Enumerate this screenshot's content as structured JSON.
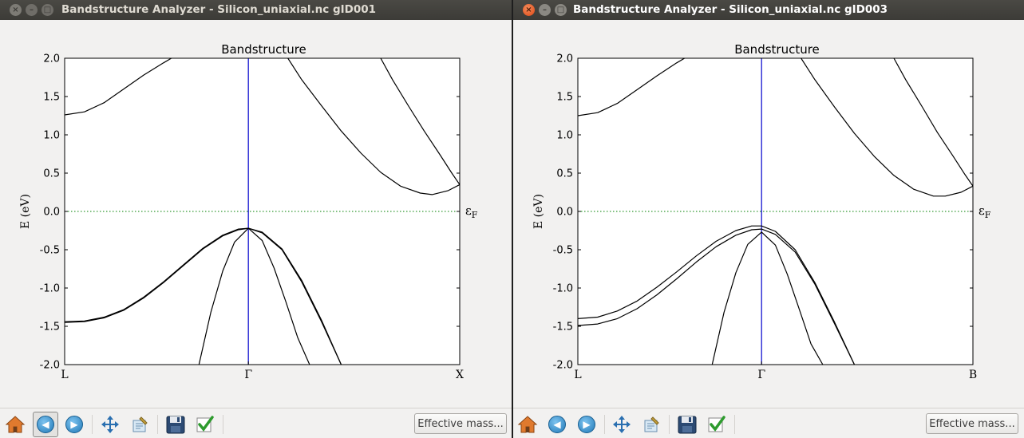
{
  "windows": [
    {
      "id": "win1",
      "title": "Bandstructure Analyzer - Silicon_uniaxial.nc gID001",
      "chart_data": {
        "type": "line",
        "title": "Bandstructure",
        "ylabel": "E (eV)",
        "ylim": [
          -2.0,
          2.0
        ],
        "xlim": [
          0,
          1
        ],
        "yticks": [
          "2.0",
          "1.5",
          "1.0",
          "0.5",
          "0.0",
          "-0.5",
          "-1.0",
          "-1.5",
          "-2.0"
        ],
        "xtick_labels": [
          "L",
          "Γ",
          "X"
        ],
        "xtick_positions": [
          0,
          0.465,
          1
        ],
        "fermi_label": "εF",
        "fermi_level": 0.0,
        "gamma_line_color": "#0000cc",
        "fermi_line_color": "#008000",
        "series": [
          {
            "x": [
              0.0,
              0.05,
              0.1,
              0.15,
              0.2,
              0.25,
              0.27
            ],
            "y": [
              1.26,
              1.3,
              1.42,
              1.6,
              1.78,
              1.94,
              2.0
            ]
          },
          {
            "x": [
              0.565,
              0.6,
              0.65,
              0.7,
              0.75,
              0.8,
              0.85,
              0.9,
              0.93,
              0.97,
              1.0
            ],
            "y": [
              2.0,
              1.72,
              1.38,
              1.05,
              0.76,
              0.51,
              0.33,
              0.24,
              0.22,
              0.27,
              0.35
            ]
          },
          {
            "x": [
              0.8,
              0.83,
              0.87,
              0.91,
              0.95,
              0.98,
              1.0
            ],
            "y": [
              2.0,
              1.72,
              1.38,
              1.05,
              0.74,
              0.5,
              0.35
            ]
          },
          {
            "x": [
              0.0,
              0.05,
              0.1,
              0.15,
              0.2,
              0.25,
              0.3,
              0.35,
              0.4,
              0.44,
              0.465,
              0.5,
              0.55,
              0.6,
              0.65,
              0.7
            ],
            "y": [
              -1.44,
              -1.43,
              -1.38,
              -1.28,
              -1.12,
              -0.92,
              -0.7,
              -0.48,
              -0.31,
              -0.23,
              -0.22,
              -0.27,
              -0.49,
              -0.9,
              -1.42,
              -2.0
            ]
          },
          {
            "x": [
              0.0,
              0.05,
              0.1,
              0.15,
              0.2,
              0.25,
              0.3,
              0.35,
              0.4,
              0.44,
              0.465,
              0.5,
              0.55,
              0.6,
              0.65,
              0.7
            ],
            "y": [
              -1.45,
              -1.44,
              -1.39,
              -1.29,
              -1.13,
              -0.93,
              -0.71,
              -0.49,
              -0.32,
              -0.24,
              -0.22,
              -0.28,
              -0.5,
              -0.92,
              -1.44,
              -2.0
            ]
          },
          {
            "x": [
              0.34,
              0.37,
              0.4,
              0.43,
              0.465,
              0.5,
              0.53,
              0.56,
              0.59,
              0.62
            ],
            "y": [
              -2.0,
              -1.32,
              -0.78,
              -0.4,
              -0.22,
              -0.38,
              -0.74,
              -1.18,
              -1.65,
              -2.0
            ]
          }
        ]
      },
      "toolbar": {
        "effective_mass_label": "Effective mass...",
        "active_button": "back"
      }
    },
    {
      "id": "win2",
      "title": "Bandstructure Analyzer - Silicon_uniaxial.nc gID003",
      "chart_data": {
        "type": "line",
        "title": "Bandstructure",
        "ylabel": "E (eV)",
        "ylim": [
          -2.0,
          2.0
        ],
        "xlim": [
          0,
          1
        ],
        "yticks": [
          "2.0",
          "1.5",
          "1.0",
          "0.5",
          "0.0",
          "-0.5",
          "-1.0",
          "-1.5",
          "-2.0"
        ],
        "xtick_labels": [
          "L",
          "Γ",
          "B"
        ],
        "xtick_positions": [
          0,
          0.465,
          1
        ],
        "fermi_label": "εF",
        "fermi_level": 0.0,
        "gamma_line_color": "#0000cc",
        "fermi_line_color": "#008000",
        "series": [
          {
            "x": [
              0.0,
              0.05,
              0.1,
              0.15,
              0.2,
              0.25,
              0.27
            ],
            "y": [
              1.25,
              1.29,
              1.41,
              1.59,
              1.77,
              1.94,
              2.0
            ]
          },
          {
            "x": [
              0.565,
              0.6,
              0.65,
              0.7,
              0.75,
              0.8,
              0.85,
              0.9,
              0.93,
              0.97,
              1.0
            ],
            "y": [
              2.0,
              1.72,
              1.36,
              1.02,
              0.72,
              0.47,
              0.29,
              0.2,
              0.2,
              0.25,
              0.33
            ]
          },
          {
            "x": [
              0.8,
              0.83,
              0.87,
              0.91,
              0.95,
              0.98,
              1.0
            ],
            "y": [
              2.0,
              1.72,
              1.38,
              1.03,
              0.72,
              0.48,
              0.33
            ]
          },
          {
            "x": [
              0.0,
              0.05,
              0.1,
              0.15,
              0.2,
              0.25,
              0.3,
              0.35,
              0.4,
              0.44,
              0.465,
              0.5,
              0.55,
              0.6,
              0.65,
              0.7
            ],
            "y": [
              -1.4,
              -1.38,
              -1.3,
              -1.17,
              -0.99,
              -0.79,
              -0.58,
              -0.39,
              -0.25,
              -0.19,
              -0.19,
              -0.26,
              -0.5,
              -0.93,
              -1.45,
              -2.0
            ]
          },
          {
            "x": [
              0.0,
              0.05,
              0.1,
              0.15,
              0.2,
              0.25,
              0.3,
              0.35,
              0.4,
              0.44,
              0.465,
              0.5,
              0.55,
              0.6,
              0.65,
              0.7
            ],
            "y": [
              -1.49,
              -1.47,
              -1.4,
              -1.27,
              -1.09,
              -0.88,
              -0.66,
              -0.46,
              -0.31,
              -0.24,
              -0.23,
              -0.3,
              -0.53,
              -0.95,
              -1.47,
              -2.0
            ]
          },
          {
            "x": [
              0.34,
              0.37,
              0.4,
              0.43,
              0.465,
              0.5,
              0.53,
              0.56,
              0.59,
              0.62
            ],
            "y": [
              -2.0,
              -1.32,
              -0.8,
              -0.43,
              -0.27,
              -0.44,
              -0.82,
              -1.27,
              -1.73,
              -2.0
            ]
          }
        ]
      },
      "toolbar": {
        "effective_mass_label": "Effective mass...",
        "active_button": ""
      }
    }
  ],
  "icons": {
    "home": "home-icon",
    "back": "back-arrow-icon",
    "forward": "forward-arrow-icon",
    "pan": "pan-icon",
    "configure": "configure-subplots-icon",
    "save": "save-icon",
    "check": "checkmark-icon"
  }
}
